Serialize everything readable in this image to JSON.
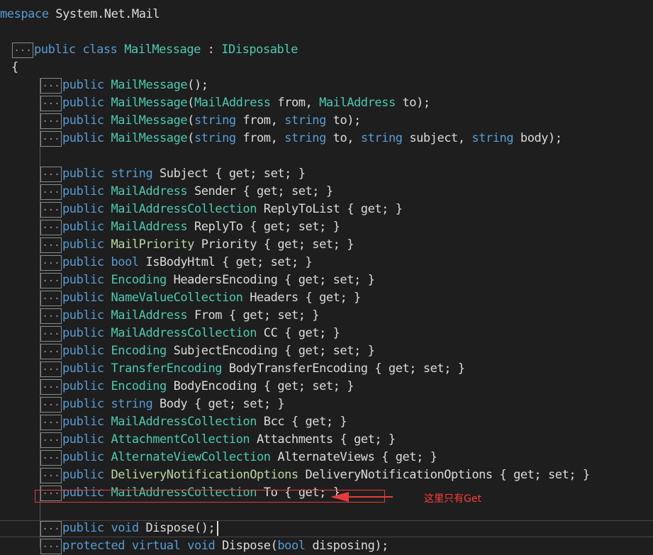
{
  "colors": {
    "background": "#1e1e1e",
    "keyword": "#569cd6",
    "type": "#4ec9b0",
    "enum": "#b8d7a3",
    "text": "#dcdcdc",
    "annotation": "#e43c3c"
  },
  "fold_marker": "...",
  "namespace_line": {
    "keyword": "mespace",
    "name": " System.Net.Mail"
  },
  "class_line": {
    "kw1": "public",
    "kw2": "class",
    "name": "MailMessage",
    "sep": " : ",
    "base": "IDisposable"
  },
  "open_brace": "{",
  "members": [
    {
      "kind": "ctor",
      "t": "MailMessage",
      "rest": "();"
    },
    {
      "kind": "ctor",
      "t": "MailMessage",
      "rest": "(",
      "p1t": "MailAddress",
      "p1": " from, ",
      "p2t": "MailAddress",
      "p2": " to);"
    },
    {
      "kind": "ctor",
      "t": "MailMessage",
      "rest": "(",
      "p1t": "string",
      "p1": " from, ",
      "p2t": "string",
      "p2": " to);"
    },
    {
      "kind": "ctor4",
      "t": "MailMessage",
      "rest": "(",
      "p1t": "string",
      "p1": " from, ",
      "p2t": "string",
      "p2": " to, ",
      "p3t": "string",
      "p3": " subject, ",
      "p4t": "string",
      "p4": " body);"
    },
    {
      "kind": "prop",
      "t": "string",
      "name": " Subject",
      "acc": "{ get; set; }"
    },
    {
      "kind": "prop",
      "t": "MailAddress",
      "name": " Sender",
      "acc": "{ get; set; }"
    },
    {
      "kind": "prop",
      "t": "MailAddressCollection",
      "name": " ReplyToList",
      "acc": "{ get; }"
    },
    {
      "kind": "prop",
      "t": "MailAddress",
      "name": " ReplyTo",
      "acc": "{ get; set; }"
    },
    {
      "kind": "prop",
      "t": "MailPriority",
      "name": " Priority",
      "acc": "{ get; set; }"
    },
    {
      "kind": "prop",
      "t": "bool",
      "name": " IsBodyHtml",
      "acc": "{ get; set; }"
    },
    {
      "kind": "prop",
      "t": "Encoding",
      "name": " HeadersEncoding",
      "acc": "{ get; set; }"
    },
    {
      "kind": "prop",
      "t": "NameValueCollection",
      "name": " Headers",
      "acc": "{ get; }"
    },
    {
      "kind": "prop",
      "t": "MailAddress",
      "name": " From",
      "acc": "{ get; set; }"
    },
    {
      "kind": "prop",
      "t": "MailAddressCollection",
      "name": " CC",
      "acc": "{ get; }"
    },
    {
      "kind": "prop",
      "t": "Encoding",
      "name": " SubjectEncoding",
      "acc": "{ get; set; }"
    },
    {
      "kind": "prop",
      "t": "TransferEncoding",
      "name": " BodyTransferEncoding",
      "acc": "{ get; set; }"
    },
    {
      "kind": "prop",
      "t": "Encoding",
      "name": " BodyEncoding",
      "acc": "{ get; set; }"
    },
    {
      "kind": "prop",
      "t": "string",
      "name": " Body",
      "acc": "{ get; set; }"
    },
    {
      "kind": "prop",
      "t": "MailAddressCollection",
      "name": " Bcc",
      "acc": "{ get; }"
    },
    {
      "kind": "prop",
      "t": "AttachmentCollection",
      "name": " Attachments",
      "acc": "{ get; }"
    },
    {
      "kind": "prop",
      "t": "AlternateViewCollection",
      "name": " AlternateViews",
      "acc": "{ get; }"
    },
    {
      "kind": "prop",
      "t": "DeliveryNotificationOptions",
      "name": " DeliveryNotificationOptions",
      "acc": "{ get; set; }"
    },
    {
      "kind": "prop",
      "t": "MailAddressCollection",
      "name": " To",
      "acc": "{ get; }"
    },
    {
      "kind": "method",
      "kw2": "void",
      "name": " Dispose();"
    },
    {
      "kind": "method2",
      "kw1": "protected",
      "kw2": "virtual",
      "kw3": "void",
      "name": " Dispose(",
      "pt": "bool",
      "p": " disposing);"
    }
  ],
  "annotation": "这里只有Get"
}
